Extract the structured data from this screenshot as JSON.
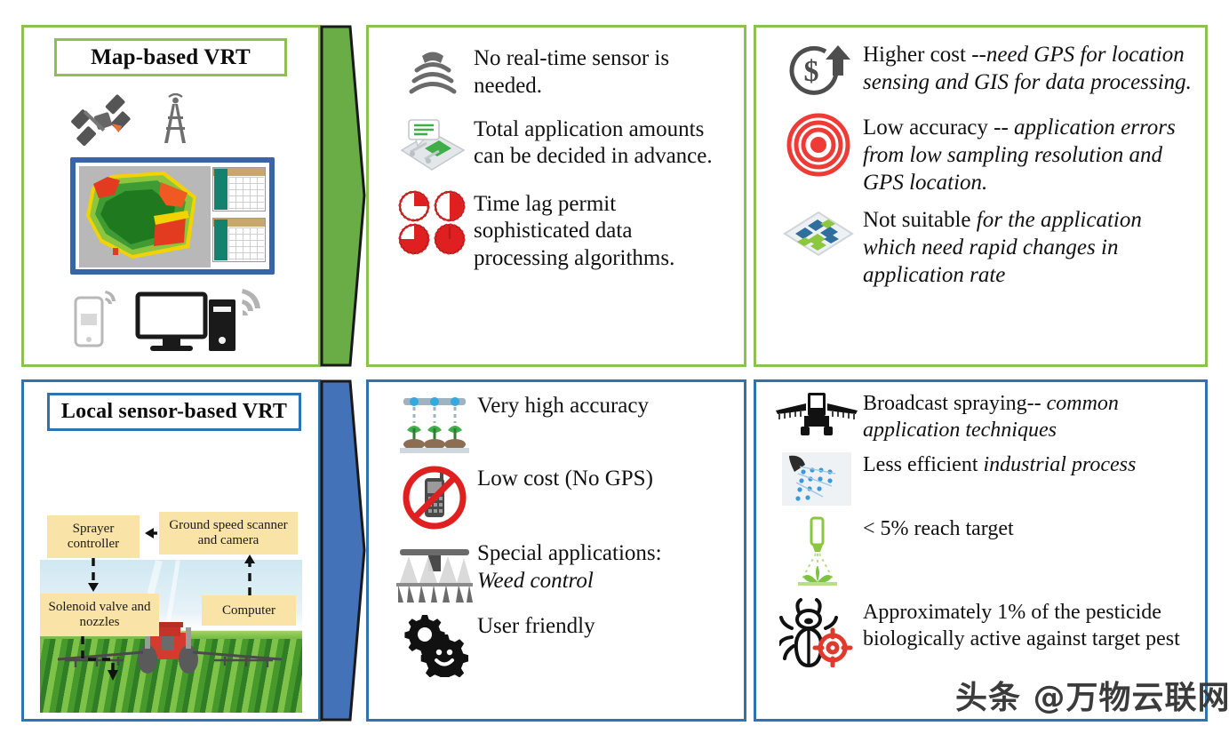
{
  "rows": {
    "top": {
      "title": "Map-based VRT",
      "theme_color": "#8CC152",
      "connector_color": "#6AAD46",
      "illustration": {
        "name": "map-based-vrt-illustration",
        "elements": [
          "satellite-icon",
          "radio-tower-icon",
          "field-prescription-map-monitor",
          "smartphone-icon",
          "desktop-computer-icon",
          "wifi-signal-icon"
        ]
      },
      "advantages": [
        {
          "icon": "sensor-waves-icon",
          "text": "No real-time sensor is needed."
        },
        {
          "icon": "map-layer-data-icon",
          "text": "Total application amounts can be decided in advance."
        },
        {
          "icon": "four-clocks-icon",
          "text": "Time lag permit sophisticated data processing algorithms."
        }
      ],
      "disadvantages": [
        {
          "icon": "cost-increase-dollar-icon",
          "lead": "Higher cost --",
          "detail": "need GPS for location sensing and GIS for data processing."
        },
        {
          "icon": "target-rings-icon",
          "lead": "Low accuracy -- ",
          "detail": "application errors from low sampling resolution and GPS location."
        },
        {
          "icon": "grid-map-tiles-icon",
          "lead": "Not suitable ",
          "detail": "for the application which need rapid changes in application rate"
        }
      ]
    },
    "bottom": {
      "title": "Local sensor-based VRT",
      "theme_color": "#2E74B5",
      "connector_color": "#4472B8",
      "illustration": {
        "name": "local-sensor-vrt-illustration",
        "flow_boxes": [
          {
            "id": "sprayer-controller",
            "label": "Sprayer controller"
          },
          {
            "id": "ground-speed-scanner",
            "label": "Ground speed scanner and camera"
          },
          {
            "id": "solenoid-valve",
            "label": "Solenoid valve and nozzles"
          },
          {
            "id": "computer",
            "label": "Computer"
          }
        ],
        "photo": "tractor-spraying-field-photo"
      },
      "advantages": [
        {
          "icon": "precision-nozzle-plants-icon",
          "lead": "Very high accuracy",
          "detail": ""
        },
        {
          "icon": "no-gps-device-icon",
          "lead": "Low cost (No GPS)",
          "detail": ""
        },
        {
          "icon": "boom-sprayer-rows-icon",
          "lead": "Special applications:",
          "detail": "Weed control"
        },
        {
          "icon": "gears-smiley-icon",
          "lead": "User friendly",
          "detail": ""
        }
      ],
      "disadvantages": [
        {
          "icon": "boom-sprayer-front-icon",
          "lead": "Broadcast spraying-- ",
          "detail": "common application techniques"
        },
        {
          "icon": "spray-droplets-icon",
          "lead": "Less efficient ",
          "detail": "industrial process"
        },
        {
          "icon": "nozzle-spraying-plant-icon",
          "lead": "< 5% reach target",
          "detail": ""
        },
        {
          "icon": "pest-target-icon",
          "lead": "Approximately 1% of the pesticide biologically active against target pest",
          "detail": ""
        }
      ]
    }
  },
  "watermark": "头条 @万物云联网"
}
